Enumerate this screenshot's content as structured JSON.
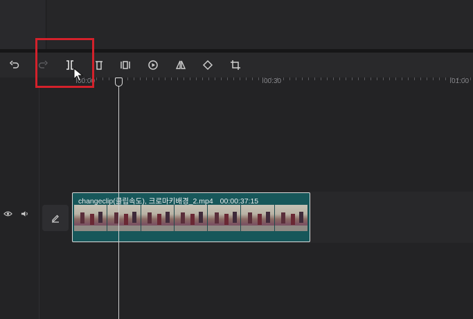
{
  "toolbar": {
    "tools": [
      {
        "name": "undo-icon"
      },
      {
        "name": "redo-icon"
      },
      {
        "name": "split-icon"
      },
      {
        "name": "delete-icon"
      },
      {
        "name": "freeze-icon"
      },
      {
        "name": "speed-icon"
      },
      {
        "name": "mirror-icon"
      },
      {
        "name": "rotate-icon"
      },
      {
        "name": "crop-icon"
      }
    ]
  },
  "ruler": {
    "labels": [
      "00:00",
      "00:30",
      "01:00"
    ]
  },
  "track": {
    "controls": {
      "visibility_icon": "eye-icon",
      "audio_icon": "speaker-icon",
      "edit_icon": "pencil-icon"
    }
  },
  "clip": {
    "title": "changeclip(클립속도), 크로마키배경_2.mp4",
    "duration": "00:00:37:15"
  },
  "colors": {
    "highlight": "#d4212b",
    "clip_bg": "#17575a"
  }
}
